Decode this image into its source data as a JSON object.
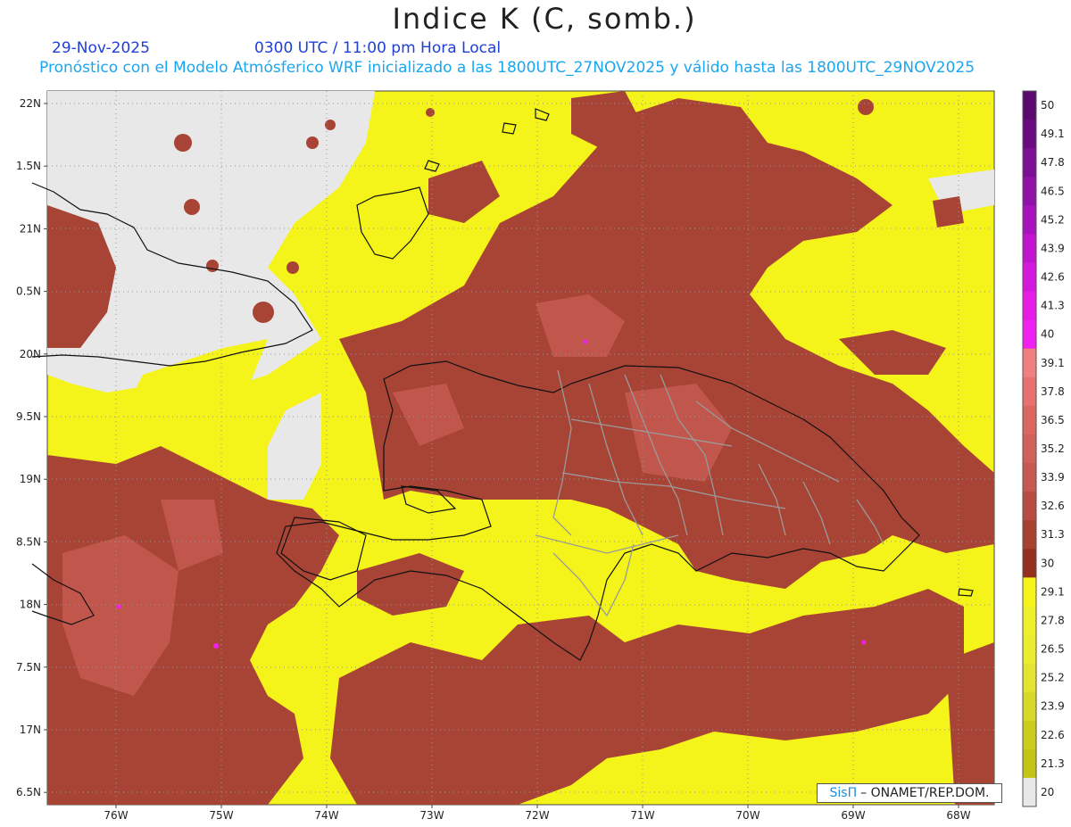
{
  "header": {
    "title": "Indice K (C, somb.)",
    "date": "29-Nov-2025",
    "time": "0300 UTC / 11:00 pm Hora Local",
    "description": "Pronóstico con el Modelo Atmósferico WRF inicializado a las 1800UTC_27NOV2025 y válido hasta las  1800UTC_29NOV2025"
  },
  "axes": {
    "lon_labels": [
      "76W",
      "75W",
      "74W",
      "73W",
      "72W",
      "71W",
      "70W",
      "69W",
      "68W"
    ],
    "lat_labels": [
      "22N",
      "1.5N",
      "21N",
      "0.5N",
      "20N",
      "9.5N",
      "19N",
      "8.5N",
      "18N",
      "7.5N",
      "17N",
      "6.5N"
    ]
  },
  "colorbar": {
    "labels": [
      "50",
      "49.1",
      "47.8",
      "46.5",
      "45.2",
      "43.9",
      "42.6",
      "41.3",
      "40",
      "39.1",
      "37.8",
      "36.5",
      "35.2",
      "33.9",
      "32.6",
      "31.3",
      "30",
      "29.1",
      "27.8",
      "26.5",
      "25.2",
      "23.9",
      "22.6",
      "21.3",
      "20"
    ],
    "colors": [
      "#5a0a6e",
      "#6a0c80",
      "#7c0f94",
      "#9010a8",
      "#a812bc",
      "#c014cf",
      "#d418dc",
      "#e81ce8",
      "#f020f0",
      "#f08080",
      "#e87070",
      "#dc6660",
      "#d0605a",
      "#c55850",
      "#b84c40",
      "#a84030",
      "#953020",
      "#f4f41a",
      "#f0f02a",
      "#ecec2e",
      "#e4e430",
      "#d8d826",
      "#cccc1c",
      "#c4c414",
      "#e8e8e8"
    ],
    "value_min": 20,
    "value_max": 50
  },
  "credit": {
    "brand": "SisΠ",
    "org": "– ONAMET/REP.DOM."
  },
  "colors": {
    "land_outside": "#e8e8e8",
    "k_low": "#f4f41a",
    "k_high": "#a84436",
    "k_higher": "#c55a50",
    "coast": "#111111",
    "province": "#999999"
  }
}
